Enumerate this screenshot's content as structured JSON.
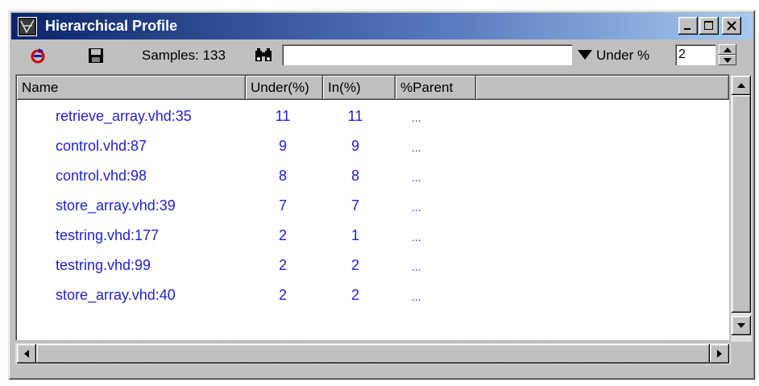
{
  "window": {
    "title": "Hierarchical Profile",
    "icon": "app-icon",
    "minimize": "_",
    "maximize": "□",
    "close": "×"
  },
  "toolbar": {
    "refresh_icon": "refresh-icon",
    "save_icon": "save-icon",
    "samples_label": "Samples: 133",
    "search_icon": "binoculars-icon",
    "search_value": "",
    "under_label": "Under %",
    "under_value": "2"
  },
  "table": {
    "columns": [
      "Name",
      "Under(%)",
      "In(%)",
      "%Parent"
    ],
    "rows": [
      {
        "name": "retrieve_array.vhd:35",
        "under": "11",
        "in": "11",
        "parent": "..."
      },
      {
        "name": "control.vhd:87",
        "under": "9",
        "in": "9",
        "parent": "..."
      },
      {
        "name": "control.vhd:98",
        "under": "8",
        "in": "8",
        "parent": "..."
      },
      {
        "name": "store_array.vhd:39",
        "under": "7",
        "in": "7",
        "parent": "..."
      },
      {
        "name": "testring.vhd:177",
        "under": "2",
        "in": "1",
        "parent": "..."
      },
      {
        "name": "testring.vhd:99",
        "under": "2",
        "in": "2",
        "parent": "..."
      },
      {
        "name": "store_array.vhd:40",
        "under": "2",
        "in": "2",
        "parent": "..."
      }
    ]
  },
  "colors": {
    "title_bar": "#0a246a",
    "row_text": "#2222cc",
    "face": "#c0c0c0"
  }
}
